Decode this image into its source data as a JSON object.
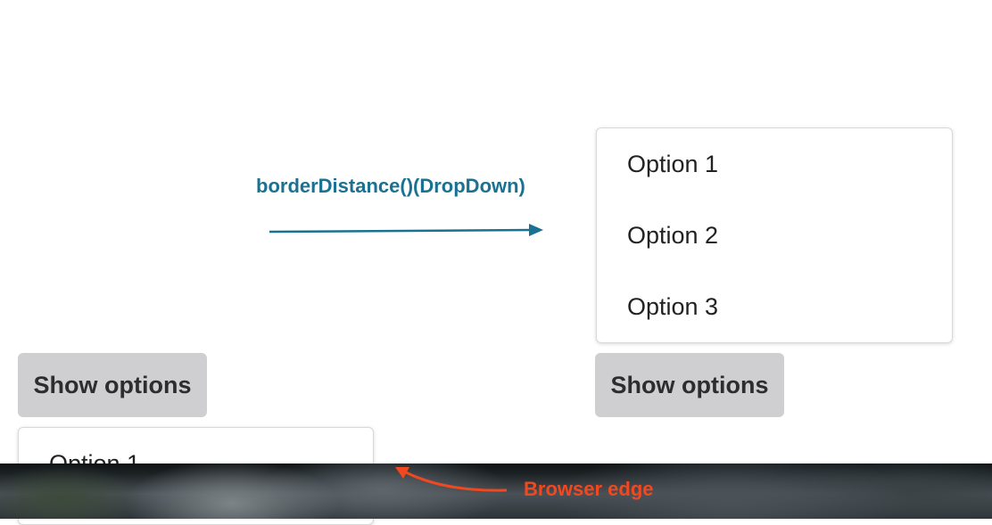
{
  "annotation": {
    "label": "borderDistance()(DropDown)",
    "color": "#1a7191"
  },
  "left_example": {
    "button_label": "Show options",
    "options": [
      "Option 1"
    ]
  },
  "right_example": {
    "button_label": "Show options",
    "options": [
      "Option 1",
      "Option 2",
      "Option 3"
    ]
  },
  "browser_edge": {
    "label": "Browser edge",
    "color": "#f2481f"
  }
}
